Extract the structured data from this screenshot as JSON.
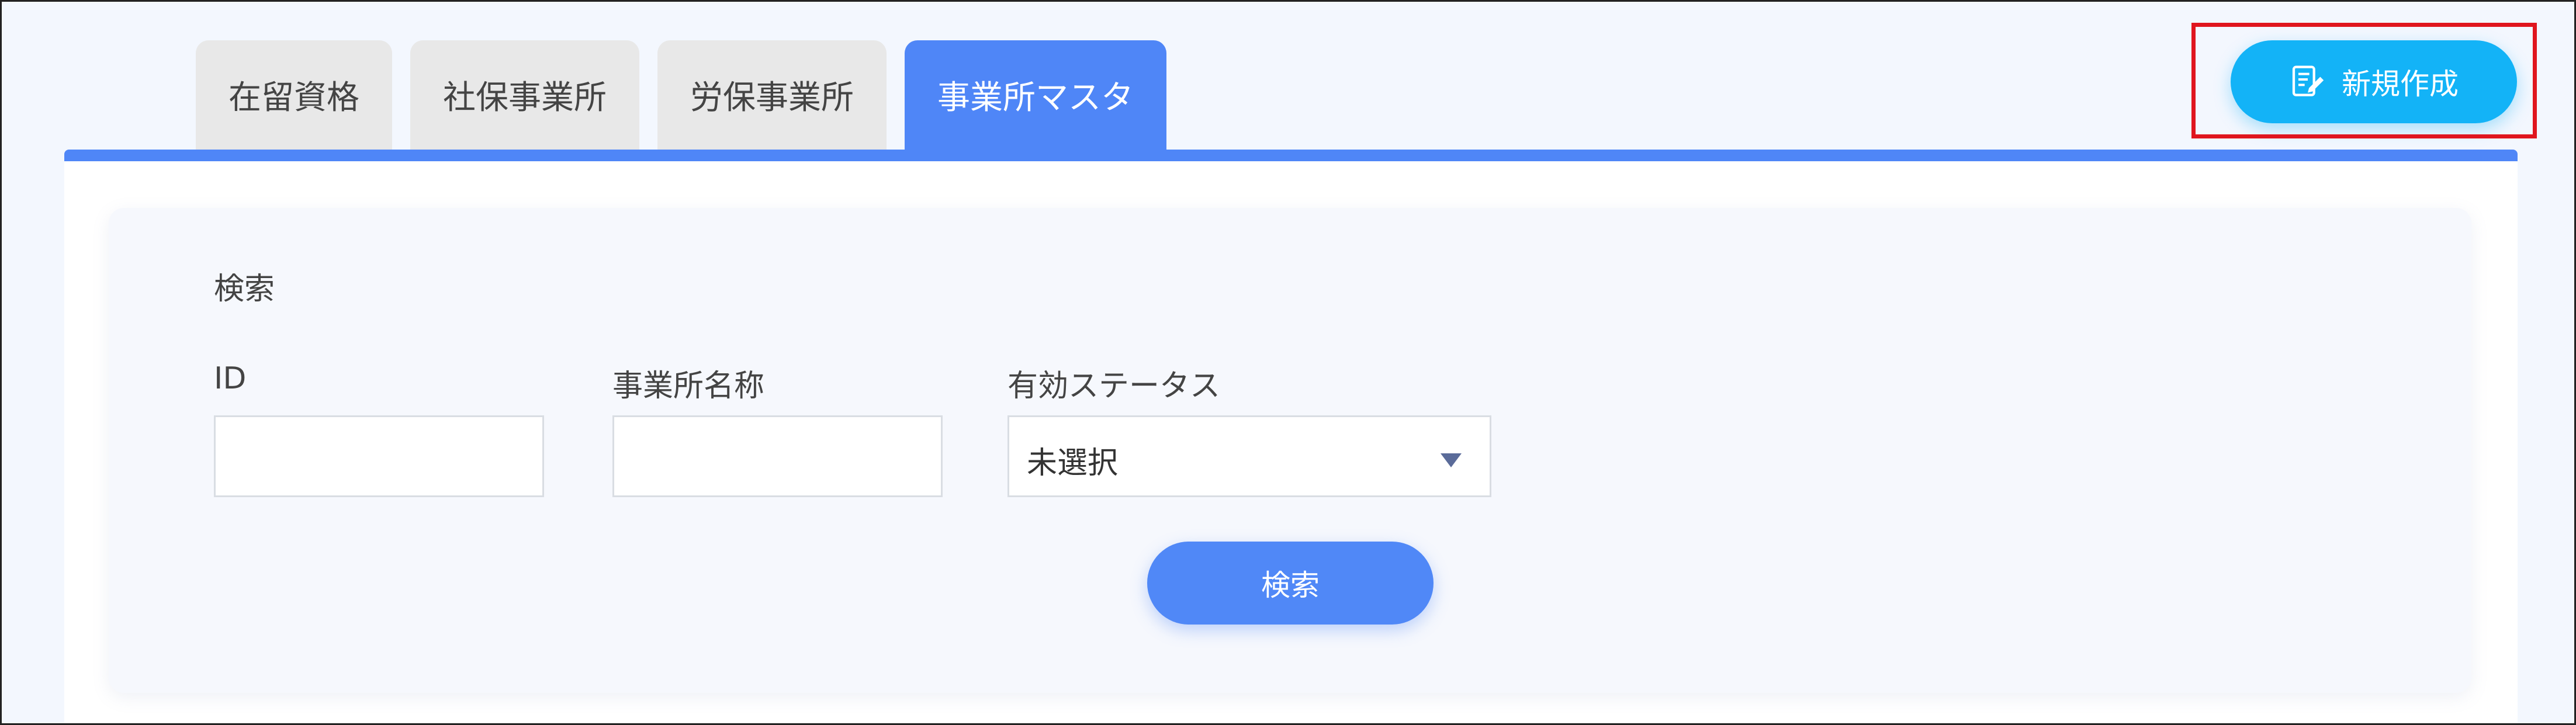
{
  "tabs": [
    {
      "label": "在留資格",
      "active": false
    },
    {
      "label": "社保事業所",
      "active": false
    },
    {
      "label": "労保事業所",
      "active": false
    },
    {
      "label": "事業所マスタ",
      "active": true
    }
  ],
  "toolbar": {
    "new_label": "新規作成",
    "new_icon": "edit-document-icon",
    "highlight_color": "#e0161e"
  },
  "search": {
    "section_title": "検索",
    "fields": {
      "id": {
        "label": "ID",
        "value": ""
      },
      "office_name": {
        "label": "事業所名称",
        "value": ""
      },
      "status": {
        "label": "有効ステータス",
        "selected": "未選択"
      }
    },
    "button_label": "検索"
  },
  "colors": {
    "accent": "#4f86f7",
    "new_button": "#13b3f7",
    "tab_inactive": "#e8e8e8"
  }
}
